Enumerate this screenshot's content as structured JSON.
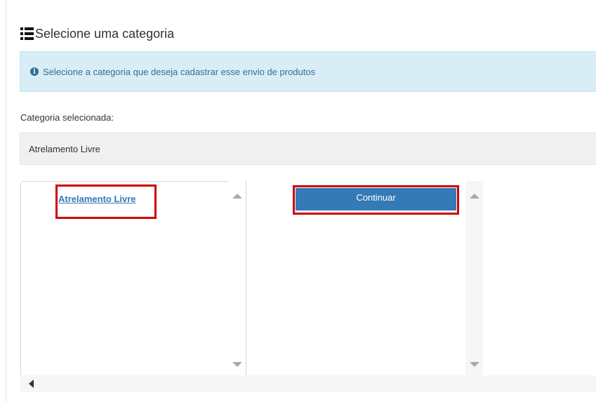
{
  "header": {
    "title": "Selecione uma categoria",
    "icon": "list-icon"
  },
  "alert": {
    "icon": "info-circle-icon",
    "glyph": "i",
    "text": "Selecione a categoria que deseja cadastrar esse envio de produtos",
    "color": "#31708f",
    "background": "#d9edf7"
  },
  "selection": {
    "label": "Categoria selecionada:",
    "value": "Atrelamento Livre"
  },
  "tree": {
    "items": [
      {
        "label": "Atrelamento Livre"
      }
    ]
  },
  "actions": {
    "continue_label": "Continuar",
    "color": "#337ab7"
  },
  "highlight_color": "#cc0000"
}
